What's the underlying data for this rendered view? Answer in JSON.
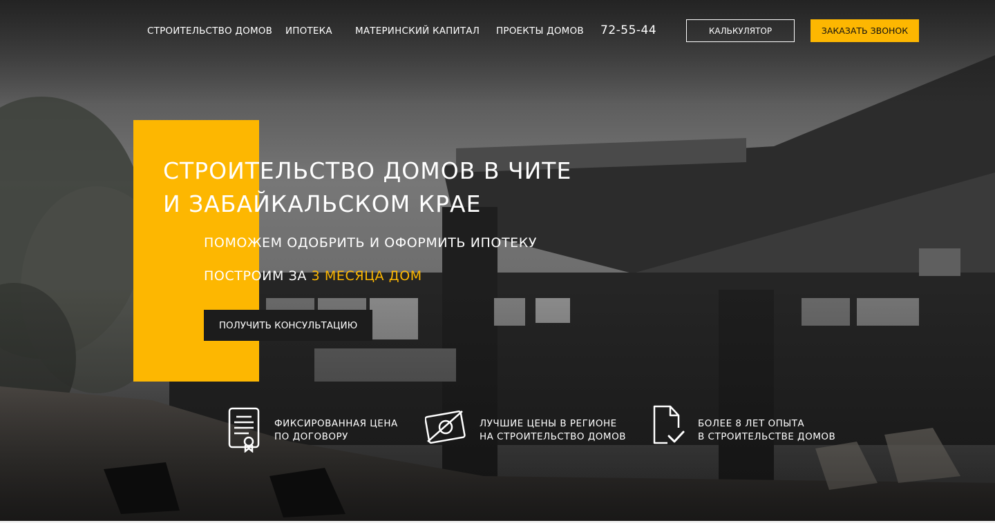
{
  "nav": {
    "links": [
      "СТРОИТЕЛЬСТВО ДОМОВ",
      "ИПОТЕКА",
      "МАТЕРИНСКИЙ КАПИТАЛ",
      "ПРОЕКТЫ ДОМОВ"
    ],
    "phone": "72-55-44",
    "calculator_button": "КАЛЬКУЛЯТОР",
    "callback_button": "ЗАКАЗАТЬ ЗВОНОК"
  },
  "hero": {
    "title_line1": "СТРОИТЕЛЬСТВО ДОМОВ В ЧИТЕ",
    "title_line2": "И  ЗАБАЙКАЛЬСКОМ КРАЕ",
    "subtitle1": "ПОМОЖЕМ ОДОБРИТЬ И ОФОРМИТЬ ИПОТЕКУ",
    "subtitle2_prefix": "ПОСТРОИМ ЗА ",
    "subtitle2_highlight": "3 МЕСЯЦА ДОМ",
    "cta_button": "ПОЛУЧИТЬ КОНСУЛЬТАЦИЮ"
  },
  "features": [
    {
      "icon": "certificate-document-icon",
      "line1": "ФИКСИРОВАННАЯ ЦЕНА",
      "line2": "ПО ДОГОВОРУ"
    },
    {
      "icon": "no-money-icon",
      "line1": "ЛУЧШИЕ ЦЕНЫ В РЕГИОНЕ",
      "line2": "НА СТРОИТЕЛЬСТВО ДОМОВ"
    },
    {
      "icon": "document-check-icon",
      "line1": "БОЛЕЕ 8 ЛЕТ ОПЫТА",
      "line2": "В СТРОИТЕЛЬСТВЕ ДОМОВ"
    }
  ],
  "colors": {
    "accent": "#fdb701",
    "dark": "#1c1c1c",
    "text": "#ffffff"
  }
}
